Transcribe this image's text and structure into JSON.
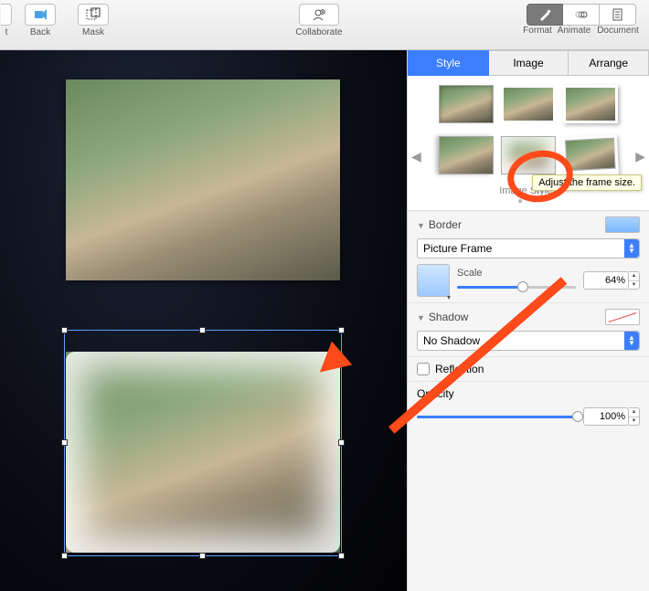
{
  "toolbar": {
    "left": [
      {
        "name": "back",
        "label": "Back",
        "icon": "back"
      },
      {
        "name": "mask",
        "label": "Mask",
        "icon": "mask"
      }
    ],
    "mid": {
      "name": "collaborate",
      "label": "Collaborate",
      "icon": "collaborate"
    },
    "right": {
      "labels": [
        "Format",
        "Animate",
        "Document"
      ],
      "activeIndex": 0
    }
  },
  "panel": {
    "tabs": [
      "Style",
      "Image",
      "Arrange"
    ],
    "activeTab": 0,
    "stylesTitle": "Image Styles",
    "navDots": "● ○"
  },
  "border": {
    "title": "Border",
    "type": "Picture Frame",
    "scaleLabel": "Scale",
    "scaleValue": "64%",
    "scalePercent": 64,
    "tooltip": "Adjust the frame size."
  },
  "shadow": {
    "title": "Shadow",
    "type": "No Shadow"
  },
  "reflection": {
    "label": "Reflection",
    "checked": false
  },
  "opacity": {
    "label": "Opacity",
    "value": "100%",
    "percent": 100
  }
}
